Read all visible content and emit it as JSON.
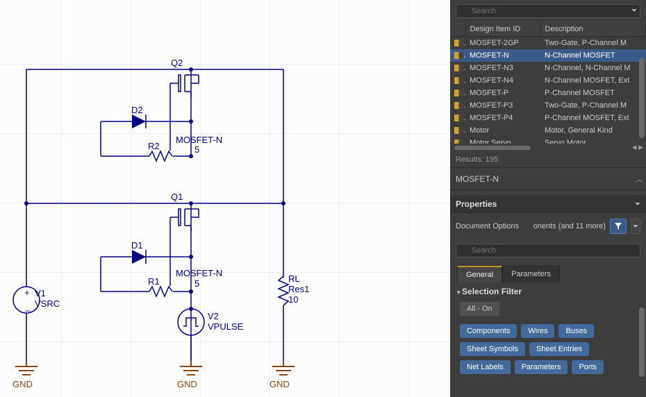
{
  "canvas": {
    "q2": "Q2",
    "q2_type": "MOSFET-N",
    "q1": "Q1",
    "q1_type": "MOSFET-N",
    "d2": "D2",
    "d1": "D1",
    "r2": "R2",
    "r2v": "5",
    "r1": "R1",
    "r1v": "5",
    "rl": "RL",
    "rl_type": "Res1",
    "rl_v": "10",
    "v1": "V1",
    "v1_type": "VSRC",
    "v2": "V2",
    "v2_type": "VPULSE",
    "gnd": "GND"
  },
  "library": {
    "search": {
      "placeholder": "Search"
    },
    "cols": {
      "id": "Design Item ID",
      "desc": "Description"
    },
    "rows": [
      {
        "id": "MOSFET-2GP",
        "desc": "Two-Gate, P-Channel M"
      },
      {
        "id": "MOSFET-N",
        "desc": "N-Channel MOSFET",
        "selected": true
      },
      {
        "id": "MOSFET-N3",
        "desc": "N-Channel, N-Channel M"
      },
      {
        "id": "MOSFET-N4",
        "desc": "N-Channel MOSFET, Ext"
      },
      {
        "id": "MOSFET-P",
        "desc": "P-Channel MOSFET"
      },
      {
        "id": "MOSFET-P3",
        "desc": "Two-Gate, P-Channel M"
      },
      {
        "id": "MOSFET-P4",
        "desc": "P-Channel MOSFET, Ext"
      },
      {
        "id": "Motor",
        "desc": "Motor, General Kind"
      },
      {
        "id": "Motor Servo",
        "desc": "Servo Motor"
      }
    ],
    "results": "Results: 195",
    "placed": "MOSFET-N"
  },
  "props": {
    "title": "Properties",
    "doc_opts": "Document Options",
    "doc_more": "onents (and 11 more)",
    "search": {
      "placeholder": "Search"
    },
    "tabs": {
      "general": "General",
      "params": "Parameters"
    },
    "section": "Selection Filter",
    "pills": {
      "all": "All - On",
      "p1": "Components",
      "p2": "Wires",
      "p3": "Buses",
      "p4": "Sheet Symbols",
      "p5": "Sheet Entries",
      "p6": "Net Labels",
      "p7": "Parameters",
      "p8": "Ports"
    }
  }
}
